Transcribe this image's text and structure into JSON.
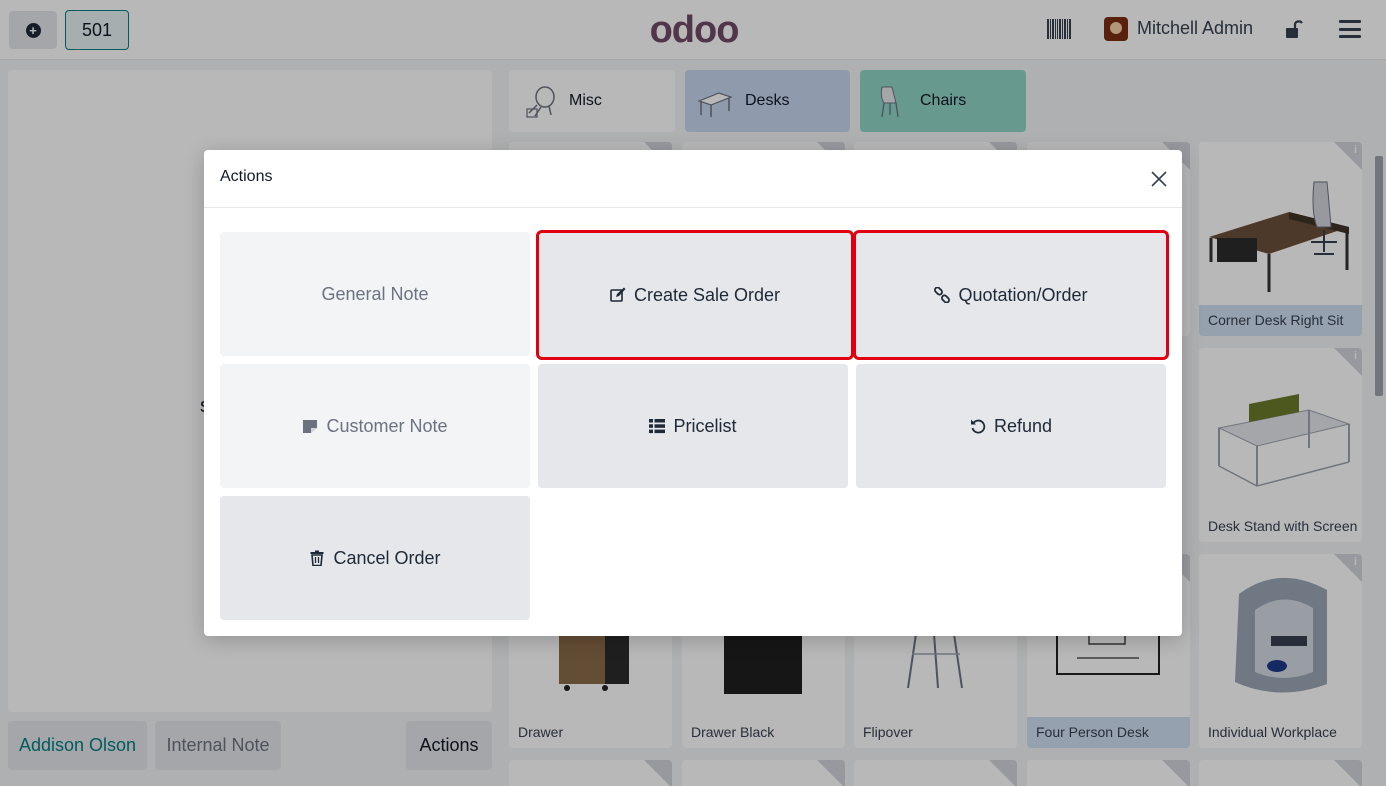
{
  "header": {
    "order_number": "501",
    "logo_text": "odoo",
    "user_name": "Mitchell Admin"
  },
  "left_panel": {
    "customer_label": "Addison Olson",
    "internal_note_label": "Internal Note",
    "actions_label": "Actions"
  },
  "categories": [
    {
      "label": "Misc",
      "color": "#ffffff"
    },
    {
      "label": "Desks",
      "color": "#c7d7f0"
    },
    {
      "label": "Chairs",
      "color": "#91d5c5"
    }
  ],
  "products": [
    {
      "name": "Corner Desk Right Sit"
    },
    {
      "name": "Desk Stand with Screen"
    },
    {
      "name": "Drawer"
    },
    {
      "name": "Drawer Black"
    },
    {
      "name": "Flipover"
    },
    {
      "name": "Four Person Desk"
    },
    {
      "name": "Individual Workplace"
    }
  ],
  "dialog": {
    "title": "Actions",
    "actions": [
      {
        "label": "General Note",
        "icon": "none"
      },
      {
        "label": "Create Sale Order",
        "icon": "edit-icon"
      },
      {
        "label": "Quotation/Order",
        "icon": "link-icon"
      },
      {
        "label": "Customer Note",
        "icon": "sticky-note-icon"
      },
      {
        "label": "Pricelist",
        "icon": "list-icon"
      },
      {
        "label": "Refund",
        "icon": "undo-icon"
      },
      {
        "label": "Cancel Order",
        "icon": "trash-icon"
      }
    ]
  },
  "colors": {
    "accent": "#017e84",
    "brand": "#714b67",
    "highlight_box": "#e0000f"
  }
}
